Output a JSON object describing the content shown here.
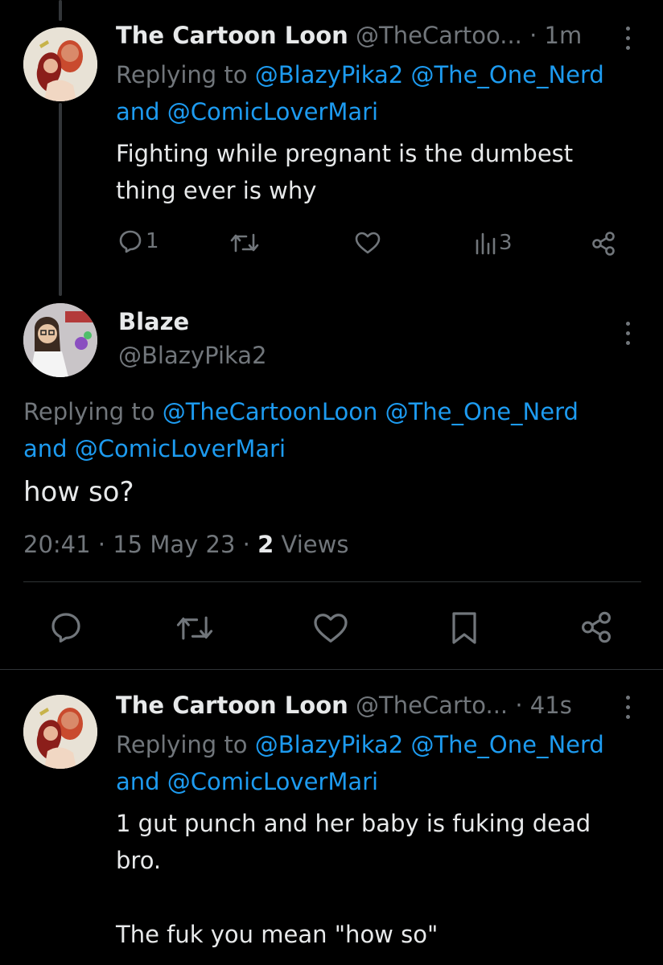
{
  "tweet1": {
    "display_name": "The Cartoon Loon",
    "handle": "@TheCartoo...",
    "separator": "·",
    "time": "1m",
    "replying_prefix": "Replying to",
    "reply_to_1": "@BlazyPika2",
    "reply_to_2": "@The_One_Nerd",
    "and_word": "and",
    "reply_to_3": "@ComicLoverMari",
    "text_line1": "Fighting while pregnant is the dumbest",
    "text_line2": "thing ever is why",
    "reply_count": "1",
    "views_count": "3",
    "avatar_icon": "cartoon-couple-avatar"
  },
  "tweet2": {
    "display_name": "Blaze",
    "handle": "@BlazyPika2",
    "replying_prefix": "Replying to",
    "reply_to_1": "@TheCartoonLoon",
    "reply_to_2": "@The_One_Nerd",
    "and_word": "and",
    "reply_to_3": "@ComicLoverMari",
    "text": "how so?",
    "time": "20:41",
    "sep1": "·",
    "date": "15 May 23",
    "sep2": "·",
    "views_count": "2",
    "views_label": "Views",
    "avatar_icon": "cartoon-scientist-avatar"
  },
  "tweet3": {
    "display_name": "The Cartoon Loon",
    "handle": "@TheCarto...",
    "separator": "·",
    "time": "41s",
    "replying_prefix": "Replying to",
    "reply_to_1": "@BlazyPika2",
    "reply_to_2": "@The_One_Nerd",
    "and_word": "and",
    "reply_to_3": "@ComicLoverMari",
    "text_line1": "1 gut punch and her baby is fuking dead",
    "text_line2": "bro.",
    "text_line3": "The fuk you mean \"how so\""
  },
  "colors": {
    "background": "#000000",
    "text": "#e7e9ea",
    "muted": "#71767b",
    "link": "#1d9bf0",
    "divider": "#2f3336"
  },
  "icons": [
    "reply-icon",
    "retweet-icon",
    "like-icon",
    "views-icon",
    "share-icon",
    "bookmark-icon",
    "more-icon"
  ]
}
